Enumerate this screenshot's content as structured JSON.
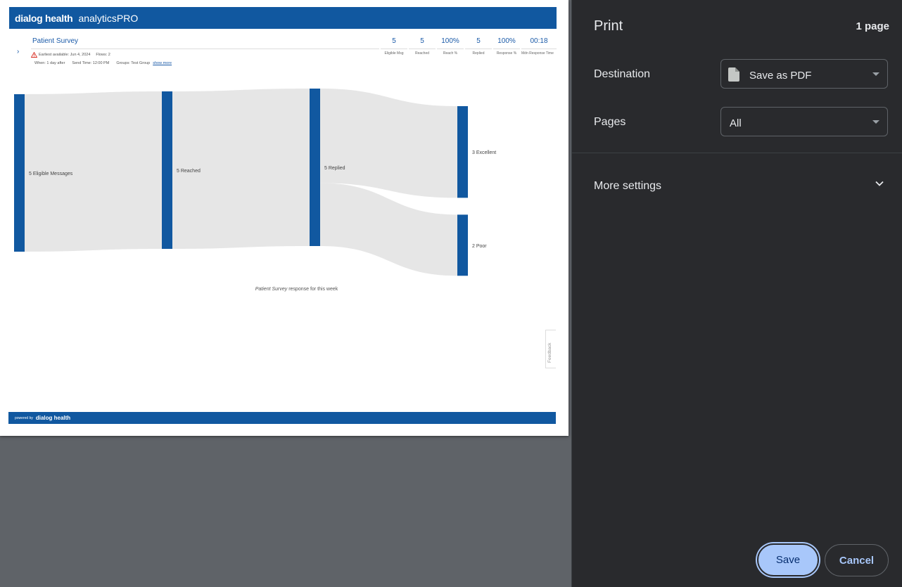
{
  "print_dialog": {
    "title": "Print",
    "page_count": "1 page",
    "destination_label": "Destination",
    "destination_value": "Save as PDF",
    "pages_label": "Pages",
    "pages_value": "All",
    "more_settings_label": "More settings",
    "save_label": "Save",
    "cancel_label": "Cancel"
  },
  "report": {
    "brand_name": "dialog health",
    "product_name": "analyticsPRO",
    "survey_title": "Patient Survey",
    "meta": {
      "earliest": "Earliest available: Jun 4, 2024",
      "flows": "Flows: 2",
      "when": "When: 1 day after",
      "send_time": "Send Time: 12:00 PM",
      "groups": "Groups: Test Group",
      "show_more": "show more"
    },
    "stats": [
      {
        "value": "5",
        "label": "Eligible Msg"
      },
      {
        "value": "5",
        "label": "Reached"
      },
      {
        "value": "100%",
        "label": "Reach %"
      },
      {
        "value": "5",
        "label": "Replied"
      },
      {
        "value": "100%",
        "label": "Response %"
      },
      {
        "value": "00:18",
        "label": "Mdn Response Time"
      }
    ],
    "caption_italic": "Patient Survey",
    "caption_rest": " response for this week",
    "feedback": "Feedback",
    "footer_powered": "powered by",
    "footer_brand": "dialog health"
  },
  "chart_data": {
    "type": "sankey",
    "nodes": [
      {
        "name": "Eligible Messages",
        "value": 5,
        "label": "5 Eligible Messages"
      },
      {
        "name": "Reached",
        "value": 5,
        "label": "5 Reached"
      },
      {
        "name": "Replied",
        "value": 5,
        "label": "5 Replied"
      },
      {
        "name": "Excellent",
        "value": 3,
        "label": "3 Excellent"
      },
      {
        "name": "Poor",
        "value": 2,
        "label": "2 Poor"
      }
    ],
    "links": [
      {
        "source": "Eligible Messages",
        "target": "Reached",
        "value": 5
      },
      {
        "source": "Reached",
        "target": "Replied",
        "value": 5
      },
      {
        "source": "Replied",
        "target": "Excellent",
        "value": 3
      },
      {
        "source": "Replied",
        "target": "Poor",
        "value": 2
      }
    ],
    "node_color": "#1158a0",
    "link_color": "#e6e6e6"
  }
}
